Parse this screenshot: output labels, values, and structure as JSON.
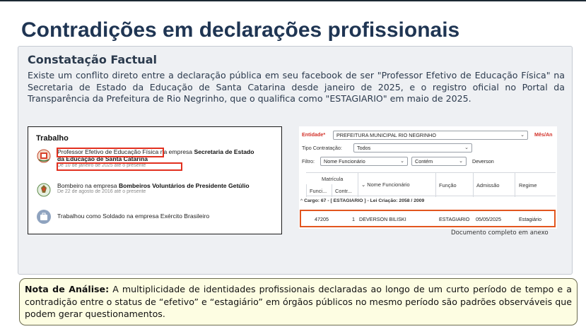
{
  "slide": {
    "title": "Contradições em declarações profissionais"
  },
  "fact": {
    "heading": "Constatação Factual",
    "text": "Existe um conflito direto entre a declaração pública em seu facebook de ser \"Professor Efetivo de Educação Física\" na Secretaria de Estado da Educação de Santa Catarina desde janeiro de 2025, e o registro oficial no Portal da Transparência da Prefeitura de Rio Negrinho, que o qualifica como \"ESTAGIARIO\" em maio de 2025."
  },
  "facebook": {
    "heading": "Trabalho",
    "items": [
      {
        "icon": "state-coat-of-arms-icon",
        "role": "Professor Efetivo de Educação Física",
        "connector": " na empresa ",
        "company": "Secretaria de Estado",
        "company_line2": "da Educação de Santa Catarina",
        "date": "De 10 de janeiro de 2025 até o presente"
      },
      {
        "icon": "firefighter-badge-icon",
        "role": "Bombeiro na empresa ",
        "company": "Bombeiros Voluntários de Presidente Getúlio",
        "date": "De 22 de agosto de 2016 até o presente"
      },
      {
        "icon": "work-briefcase-icon",
        "role": "Trabalhou como Soldado na empresa Exército Brasileiro"
      }
    ]
  },
  "portal": {
    "entity_label": "Entidade*",
    "entity_value": "PREFEITURA MUNICIPAL RIO NEGRINHO",
    "month_label": "Mês/An",
    "contract_label": "Tipo Contratação:",
    "contract_value": "Todos",
    "filter_label": "Filtro:",
    "filter_field": "Nome Funcionário",
    "filter_op": "Contém",
    "filter_value": "Deverson",
    "columns": {
      "matricula": "Matrícula",
      "func": "Funci...",
      "contr": "Contr...",
      "nome": "Nome Funcionário",
      "funcao": "Função",
      "admissao": "Admissão",
      "regime": "Regime"
    },
    "cargo_row": "Cargo: 67 - [ ESTAGIARIO ] - Lei Criação: 2058 / 2009",
    "row": {
      "func": "47205",
      "contr": "1",
      "nome": "DEVERSON BILISKI",
      "funcao": "ESTAGIARIO",
      "admissao": "05/05/2025",
      "regime": "Estagiário"
    },
    "caption": "Documento completo em anexo"
  },
  "note": {
    "label": "Nota de Análise:",
    "text": " A multiplicidade de identidades profissionais declaradas ao longo de um curto período de tempo e a contradição entre o status de “efetivo” e “estagiário” em órgãos públicos no mesmo período são padrões observáveis que podem gerar questionamentos."
  },
  "colors": {
    "title": "#1f3553",
    "highlight": "#e2301f",
    "note_bg": "#fdfde2",
    "panel_bg": "#eef0f3"
  }
}
